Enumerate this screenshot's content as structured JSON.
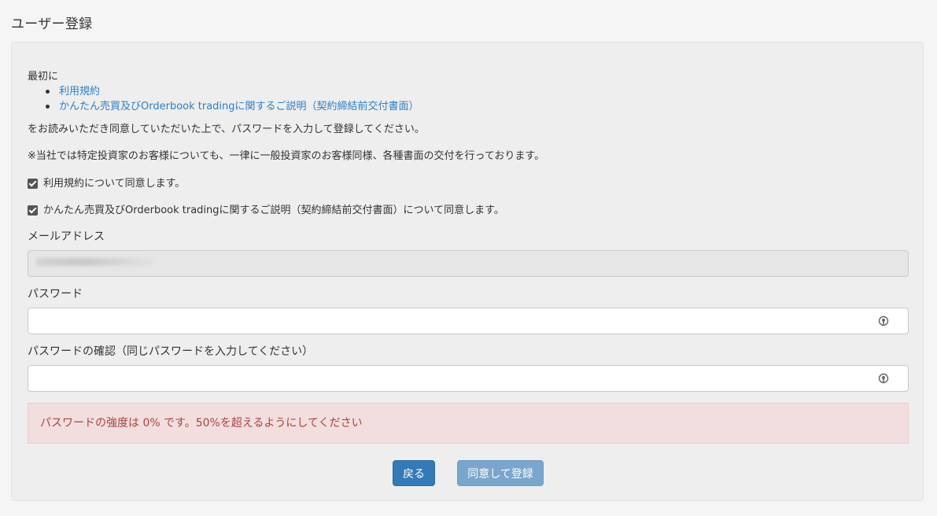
{
  "page": {
    "title": "ユーザー登録"
  },
  "intro": {
    "lead": "最初に",
    "documents": [
      "利用規約",
      "かんたん売買及びOrderbook tradingに関するご説明（契約締結前交付書面）"
    ],
    "instruction": "をお読みいただき同意していただいた上で、パスワードを入力して登録してください。",
    "notice": "※当社では特定投資家のお客様についても、一律に一般投資家のお客様同様、各種書面の交付を行っております。"
  },
  "agreements": [
    {
      "label": "利用規約について同意します。",
      "checked": true
    },
    {
      "label": "かんたん売買及びOrderbook tradingに関するご説明（契約締結前交付書面）について同意します。",
      "checked": true
    }
  ],
  "form": {
    "email_label": "メールアドレス",
    "password_label": "パスワード",
    "password_confirm_label": "パスワードの確認（同じパスワードを入力してください）"
  },
  "alert": {
    "message": "パスワードの強度は 0% です。50%を超えるようにしてください"
  },
  "buttons": {
    "back": "戻る",
    "submit": "同意して登録"
  },
  "colors": {
    "link": "#2c7fc6",
    "alert_bg": "#f2dede",
    "alert_text": "#a94442",
    "primary": "#337ab7",
    "primary_disabled": "#7aa5cc"
  },
  "icons": {
    "password_reveal": "eye-reveal-icon"
  }
}
